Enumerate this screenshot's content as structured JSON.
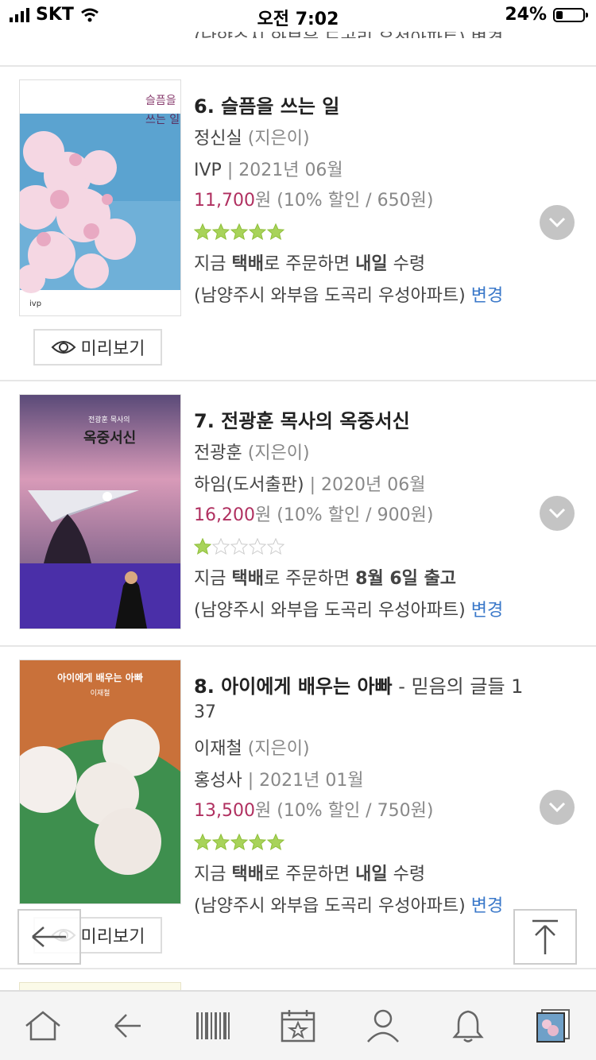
{
  "status": {
    "carrier": "SKT",
    "time": "오전 7:02",
    "battery": "24%"
  },
  "clipped_previous_line": "(남양주시 와부읍 도곡리 우성아파트) 변경",
  "books": [
    {
      "title": "6. 슬픔을 쓰는 일",
      "subtitle": "",
      "author": "정신실",
      "author_role": "(지은이)",
      "publisher": "IVP",
      "date": "| 2021년 06월",
      "price": "11,700",
      "price_unit": "원",
      "discount": "(10% 할인 / 650원)",
      "rating": 5,
      "delivery_prefix": "지금 ",
      "delivery_method": "택배",
      "delivery_mid": "로 주문하면 ",
      "delivery_when": "내일",
      "delivery_suffix": " 수령",
      "address": "(남양주시 와부읍 도곡리 우성아파트)",
      "change": "변경",
      "preview": "미리보기",
      "cover_text": {
        "title": "슬픔을 쓰는 일",
        "pub": "ivp"
      }
    },
    {
      "title": "7. 전광훈 목사의 옥중서신",
      "subtitle": "",
      "author": "전광훈",
      "author_role": "(지은이)",
      "publisher": "하임(도서출판)",
      "date": "| 2020년 06월",
      "price": "16,200",
      "price_unit": "원",
      "discount": "(10% 할인 / 900원)",
      "rating": 1,
      "delivery_prefix": "지금 ",
      "delivery_method": "택배",
      "delivery_mid": "로 주문하면 ",
      "delivery_when": "8월 6일 출고",
      "delivery_suffix": "",
      "address": "(남양주시 와부읍 도곡리 우성아파트)",
      "change": "변경",
      "cover_text": {
        "small": "전광훈 목사의",
        "title": "옥중서신"
      }
    },
    {
      "title": "8. 아이에게 배우는 아빠",
      "subtitle": " - 믿음의 글들 1",
      "subtitle_wrap": "37",
      "author": "이재철",
      "author_role": "(지은이)",
      "publisher": "홍성사",
      "date": "| 2021년 01월",
      "price": "13,500",
      "price_unit": "원",
      "discount": "(10% 할인 / 750원)",
      "rating": 5,
      "delivery_prefix": "지금 ",
      "delivery_method": "택배",
      "delivery_mid": "로 주문하면 ",
      "delivery_when": "내일",
      "delivery_suffix": " 수령",
      "address": "(남양주시 와부읍 도곡리 우성아파트)",
      "change": "변경",
      "preview": "미리보기",
      "cover_text": {
        "title": "아이에게 배우는 아빠",
        "author": "이재철"
      }
    }
  ],
  "colors": {
    "price": "#b03060",
    "link": "#3a78c9",
    "star_on": "#a8d35a",
    "star_off": "#dddddd"
  },
  "tabbar": [
    "home-icon",
    "back-arrow-icon",
    "barcode-icon",
    "calendar-star-icon",
    "person-icon",
    "bell-icon",
    "recent-book-icon"
  ]
}
